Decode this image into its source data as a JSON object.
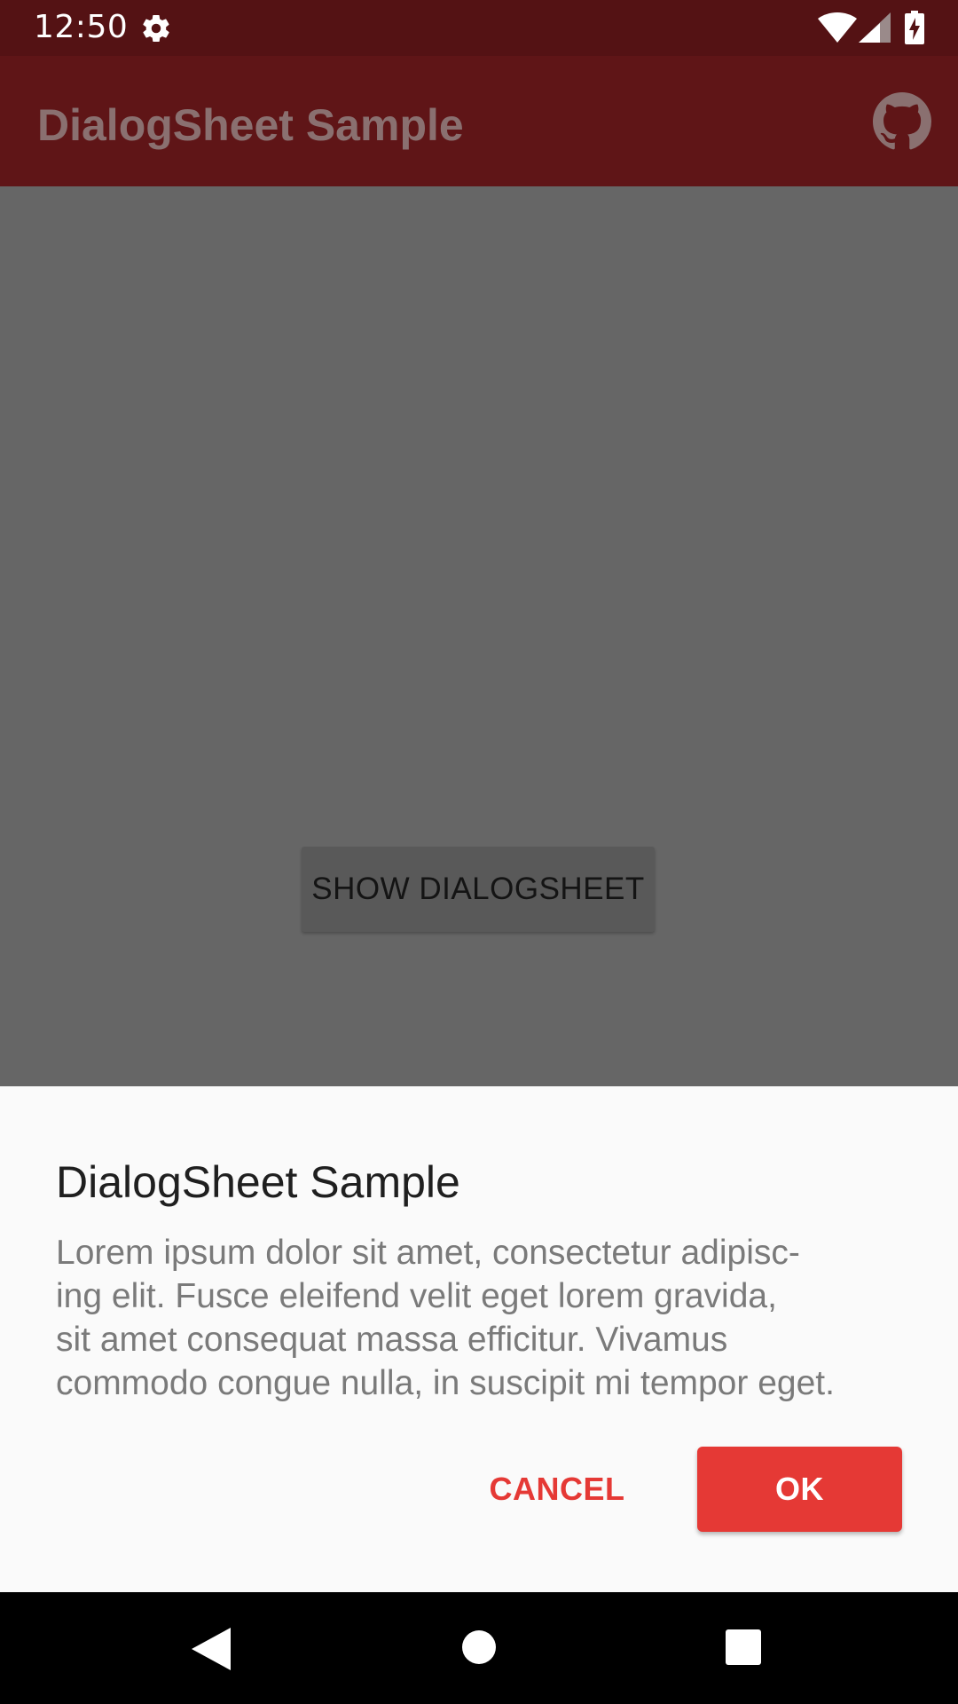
{
  "status_bar": {
    "time": "12:50",
    "icons": [
      "settings-gear-icon",
      "wifi-icon",
      "cell-signal-icon",
      "battery-charging-icon"
    ]
  },
  "toolbar": {
    "title": "DialogSheet Sample",
    "action_icon": "github-icon"
  },
  "content": {
    "show_button_label": "SHOW DIALOGSHEET"
  },
  "dialog": {
    "title": "DialogSheet Sample",
    "message": "Lorem ipsum dolor sit amet, consectetur adipisc-\ning elit. Fusce eleifend velit eget lorem gravida,\nsit amet consequat massa efficitur. Vivamus\ncommodo congue nulla, in suscipit mi tempor eget.",
    "cancel_label": "CANCEL",
    "ok_label": "OK"
  },
  "nav_bar": {
    "icons": [
      "back-icon",
      "home-icon",
      "recents-icon"
    ]
  },
  "colors": {
    "accent": "#e53935",
    "primary_dimmed": "#5f1517",
    "status_dimmed": "#541214",
    "scrim": "#666666"
  }
}
